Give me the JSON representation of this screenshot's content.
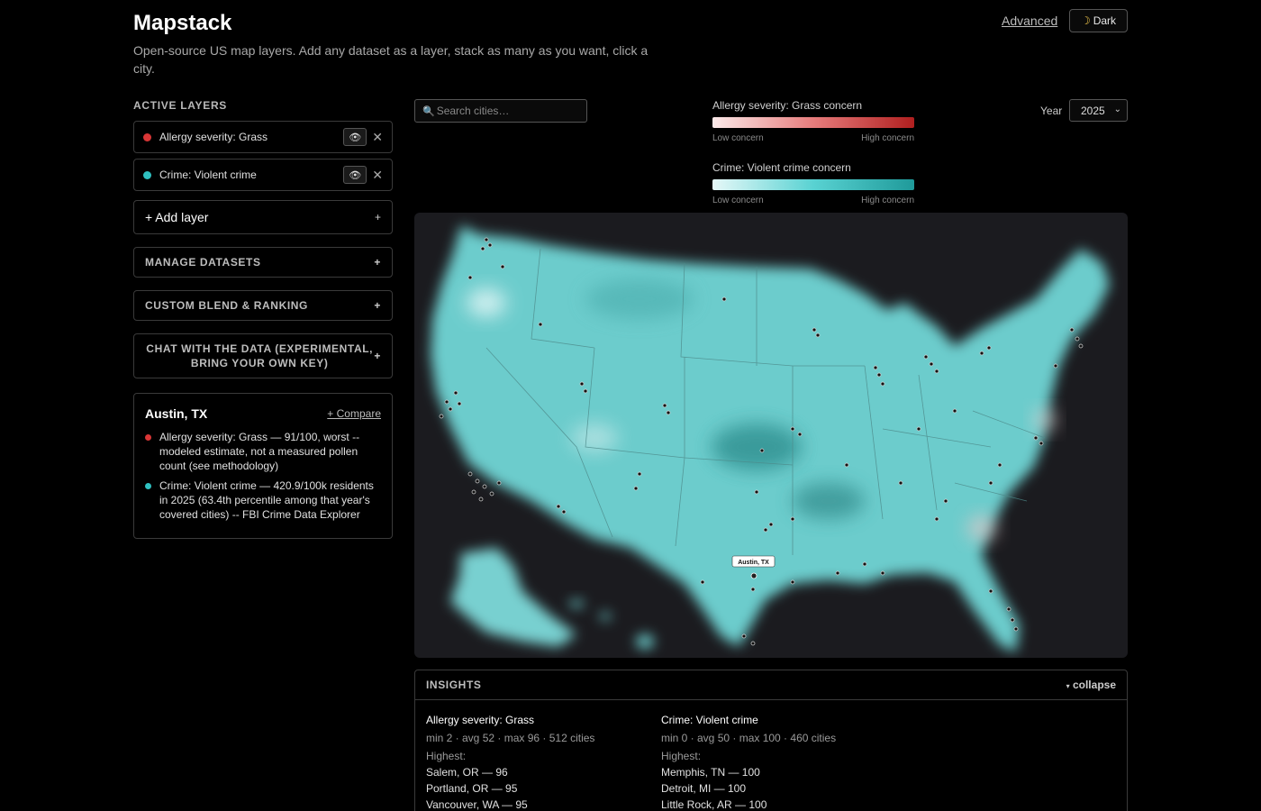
{
  "app": {
    "title": "Mapstack",
    "subtitle": "Open-source US map layers. Add any dataset as a layer, stack as many as you want, click a city.",
    "advanced_label": "Advanced",
    "theme_label": "Dark",
    "theme_icon": "moon-icon"
  },
  "sidebar": {
    "active_layers_label": "ACTIVE LAYERS",
    "layers": [
      {
        "name": "Allergy severity: Grass",
        "color": "#d93636",
        "visibility_icon": "eye-icon",
        "remove_icon": "close-icon"
      },
      {
        "name": "Crime: Violent crime",
        "color": "#2fc0c0",
        "visibility_icon": "eye-icon",
        "remove_icon": "close-icon"
      }
    ],
    "add_layer_label": "+ Add layer",
    "manage_datasets_label": "MANAGE DATASETS",
    "custom_blend_label": "CUSTOM BLEND & RANKING",
    "chat_label": "CHAT WITH THE DATA (EXPERIMENTAL, BRING YOUR OWN KEY)",
    "expand_icon": "+"
  },
  "city_card": {
    "name": "Austin, TX",
    "compare_label": "+ Compare",
    "lines": [
      {
        "color": "#d93636",
        "text": "Allergy severity: Grass — 91/100, worst -- modeled estimate, not a measured pollen count (see methodology)"
      },
      {
        "color": "#2fc0c0",
        "text": "Crime: Violent crime — 420.9/100k residents in 2025 (63.4th percentile among that year's covered cities) -- FBI Crime Data Explorer"
      }
    ]
  },
  "search": {
    "placeholder": "Search cities…"
  },
  "legends": [
    {
      "title": "Allergy severity: Grass concern",
      "low": "Low concern",
      "high": "High concern",
      "gradient": [
        "#fbe9e9",
        "#e67c7c",
        "#b01f1f"
      ]
    },
    {
      "title": "Crime: Violent crime concern",
      "low": "Low concern",
      "high": "High concern",
      "gradient": [
        "#e6f8f8",
        "#59d2d2",
        "#1f9a9a"
      ]
    }
  ],
  "year": {
    "label": "Year",
    "value": "2025"
  },
  "map": {
    "selected_city_label": "Austin, TX",
    "land_color": "#6ccccc",
    "background_color": "#1b1b1f"
  },
  "insights": {
    "title": "INSIGHTS",
    "collapse_label": "collapse",
    "columns": [
      {
        "name": "Allergy severity: Grass",
        "stats": "min 2 · avg 52 · max 96 · 512 cities",
        "highest_label": "Highest:",
        "highest": [
          "Salem, OR — 96",
          "Portland, OR — 95",
          "Vancouver, WA — 95"
        ]
      },
      {
        "name": "Crime: Violent crime",
        "stats": "min 0 · avg 50 · max 100 · 460 cities",
        "highest_label": "Highest:",
        "highest": [
          "Memphis, TN — 100",
          "Detroit, MI — 100",
          "Little Rock, AR — 100"
        ]
      }
    ]
  }
}
